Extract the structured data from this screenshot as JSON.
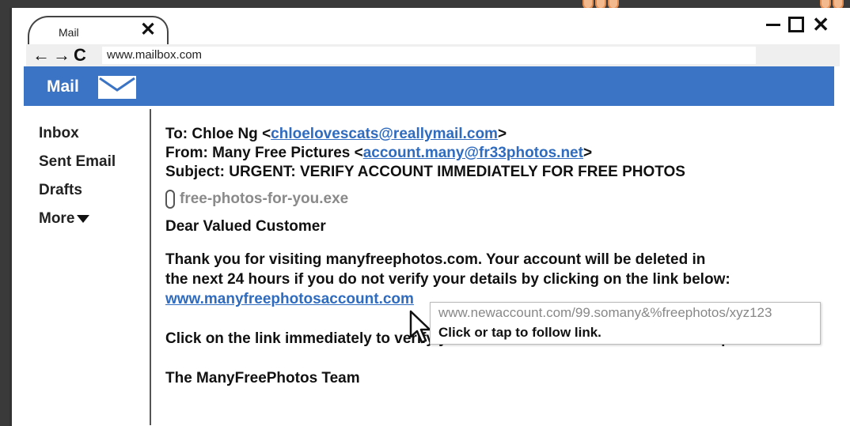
{
  "tab": {
    "title": "Mail",
    "close_glyph": "✕"
  },
  "window_controls": {
    "close_glyph": "✕"
  },
  "nav": {
    "back": "←",
    "forward": "→",
    "reload": "C",
    "url": "www.mailbox.com"
  },
  "app": {
    "title": "Mail",
    "icon": "envelope-icon",
    "brand_color": "#3b74c4"
  },
  "sidebar": {
    "items": [
      {
        "label": "Inbox"
      },
      {
        "label": "Sent Email"
      },
      {
        "label": "Drafts"
      },
      {
        "label": "More"
      }
    ]
  },
  "email": {
    "to_label": "To: Chloe Ng <",
    "to_address": "chloelovescats@reallymail.com",
    "to_suffix": ">",
    "from_label": "From: Many Free Pictures <",
    "from_address": "account.many@fr33photos.net",
    "from_suffix": ">",
    "subject": "Subject: URGENT: VERIFY ACCOUNT IMMEDIATELY FOR FREE PHOTOS",
    "attachment": "free-photos-for-you.exe",
    "greeting": "Dear Valued Customer",
    "body_line1": "Thank you for visiting manyfreephotos.com. Your account will be deleted in",
    "body_line2": "the next 24 hours if you do not verify your details by clicking on the link below:",
    "link_text": "www.manyfreephotosaccount.com",
    "closing": "Click on the link immediately to verify your details and stand to win attractive prizes!",
    "signoff": "The ManyFreePhotos Team"
  },
  "tooltip": {
    "url": "www.newaccount.com/99.somany&%freephotos/xyz123",
    "action": "Click or tap to follow link."
  },
  "colors": {
    "link": "#2f6bbf",
    "attachment_text": "#8a8a8a"
  }
}
